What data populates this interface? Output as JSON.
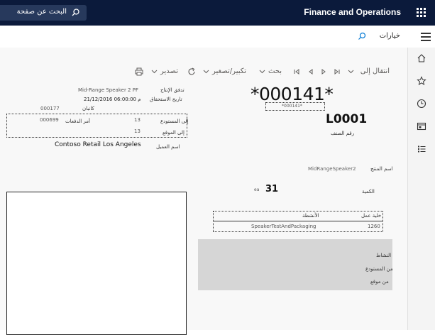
{
  "topbar": {
    "app_title": "Finance and Operations",
    "search_label": "البحث عن صفحة"
  },
  "bar2": {
    "options_label": "خيارات"
  },
  "toolbar": {
    "navigate": "انتقال إلى",
    "search": "بحث",
    "zoom": "تكبير/تصغير",
    "refresh_icon": "refresh-icon",
    "export": "تصدير",
    "print_icon": "print-icon"
  },
  "report": {
    "barcode_large": "*000141*",
    "barcode_small": "*000141*",
    "item_code": "L0001",
    "item_number_label": "رقم الصنف",
    "product_name_label": "اسم المنتج",
    "product_name_value": "MidRangeSpeaker2",
    "quantity_label": "الكمية",
    "quantity_value": "31",
    "quantity_unit": "ea",
    "production_flow_label": "تدفق الإنتاج",
    "production_flow_value": "Mid-Range Speaker 2 PF",
    "due_date_label": "تاريخ الاستحقاق",
    "due_date_value": "21/12/2016 06:00:00 م",
    "kanban_label": "كانبان",
    "kanban_value": "000177",
    "to_warehouse_label": "إلى المستودع",
    "to_warehouse_value": "13",
    "batches_label": "أمر الدفعات",
    "batches_value": "000699",
    "to_location_label": "إلى الموقع",
    "to_location_value": "13",
    "customer_label": "اسم العميل",
    "customer_value": "Contoso Retail Los Angeles",
    "table_header_cell": "خلية عمل",
    "table_header_activities": "الأنشطة",
    "table_row_cell": "1260",
    "table_row_activity": "SpeakerTestAndPackaging",
    "activity_label": "النشاط",
    "from_warehouse_label": "من المستودع",
    "from_location_label": "من موقع"
  },
  "nav_icons": [
    "home-icon",
    "star-icon",
    "clock-icon",
    "workspace-icon",
    "list-icon"
  ]
}
